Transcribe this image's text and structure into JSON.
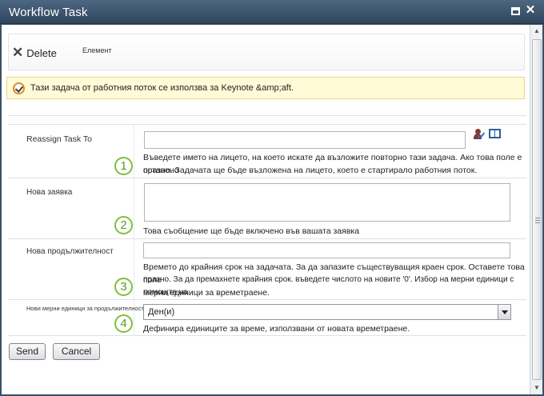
{
  "window": {
    "title": "Workflow Task",
    "maximize_icon": "maximize-icon",
    "close_label": "✕"
  },
  "ribbon": {
    "delete_label": "Delete",
    "group_label": "Елемент"
  },
  "notice": {
    "icon": "task-check-icon",
    "text": "Тази задача от работния поток се използва за Keynote &amp;aft."
  },
  "form": {
    "reassign": {
      "label": "Reassign Task To",
      "number": "1",
      "value": "",
      "description_line1": "Въведете името на лицето, на което искате да възложите повторно тази задача. Ако това поле е оставено",
      "description_line2": "празно. Задачата ще бъде възложена на лицето, което е стартирало работния поток."
    },
    "request": {
      "label": "Нова заявка",
      "number": "2",
      "value": "",
      "description": "Това съобщение ще бъде включено във вашата заявка"
    },
    "duration": {
      "label": "Нова продължителност",
      "number": "3",
      "value": "",
      "description_line1": "Времето до крайния срок на задачата. За да запазите съществуващия краен срок. Оставете това поле",
      "description_line2": "празно. За да премахнете крайния срок. въведете числото на новите '0'. Избор на мерни единици с помощта на",
      "description_line3": "мерни единици за времетраене."
    },
    "units": {
      "label": "Нови мерни единици за продължителност",
      "number": "4",
      "selected": "Ден(и)",
      "description": "Дефинира единиците за време, използвани от новата времетраене."
    }
  },
  "buttons": {
    "send": "Send",
    "cancel": "Cancel"
  }
}
